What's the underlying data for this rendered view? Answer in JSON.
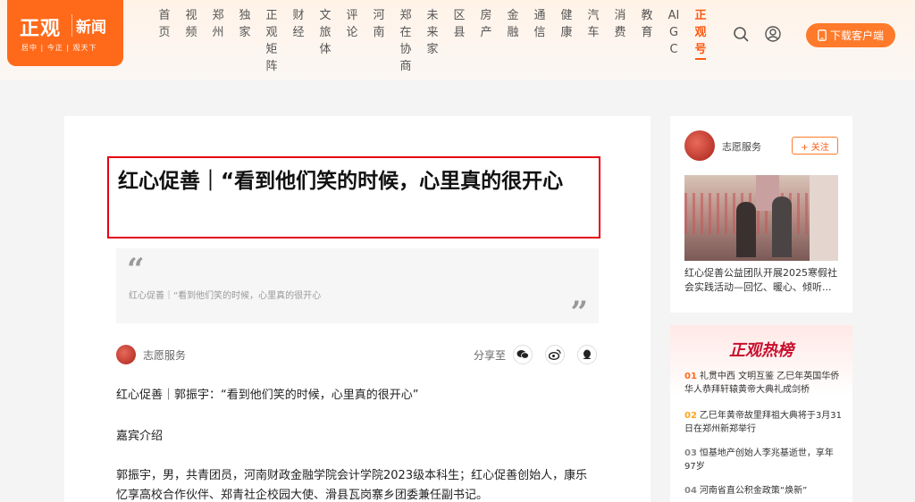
{
  "logo": {
    "brand_main": "正观",
    "brand_sub": "新闻",
    "tagline": "居中 | 今正 | 观天下"
  },
  "nav": [
    {
      "label": "首页",
      "active": false
    },
    {
      "label": "视频",
      "active": false
    },
    {
      "label": "郑州",
      "active": false
    },
    {
      "label": "独家",
      "active": false
    },
    {
      "label": "正观矩阵",
      "active": false
    },
    {
      "label": "财经",
      "active": false
    },
    {
      "label": "文旅体",
      "active": false
    },
    {
      "label": "评论",
      "active": false
    },
    {
      "label": "河南",
      "active": false
    },
    {
      "label": "郑在协商",
      "active": false
    },
    {
      "label": "未来家",
      "active": false
    },
    {
      "label": "区县",
      "active": false
    },
    {
      "label": "房产",
      "active": false
    },
    {
      "label": "金融",
      "active": false
    },
    {
      "label": "通信",
      "active": false
    },
    {
      "label": "健康",
      "active": false
    },
    {
      "label": "汽车",
      "active": false
    },
    {
      "label": "消费",
      "active": false
    },
    {
      "label": "教育",
      "active": false
    },
    {
      "label": "AIGC",
      "active": false
    },
    {
      "label": "正观号",
      "active": true
    }
  ],
  "header": {
    "download_label": "下载客户端",
    "search_icon": "search-icon",
    "user_icon": "user-icon",
    "phone_icon": "phone-icon"
  },
  "article": {
    "title": "红心促善｜“看到他们笑的时候，心里真的很开心",
    "quote_text": "红心促善｜“看到他们笑的时候，心里真的很开心",
    "author": "志愿服务",
    "share_label": "分享至",
    "share_icons": [
      "wechat-icon",
      "weibo-icon",
      "qq-icon"
    ],
    "paragraphs": [
      "红心促善｜郭振宇：“看到他们笑的时候，心里真的很开心”",
      "嘉宾介绍",
      "郭振宇，男，共青团员，河南财政金融学院会计学院2023级本科生；红心促善创始人，康乐忆享高校合作伙伴、郑青社企校园大使、滑县瓦岗寨乡团委兼任副书记。"
    ]
  },
  "sidebar": {
    "author": "志愿服务",
    "follow_label": "+ 关注",
    "caption": "红心促善公益团队开展2025寒假社会实践活动—回忆、暖心、倾听...",
    "hot_title": "正观热榜",
    "hot_list": [
      {
        "rank": "01",
        "text": "礼贯中西 文明互鉴 乙巳年英国华侨华人恭拜轩辕黄帝大典礼成剑桥"
      },
      {
        "rank": "02",
        "text": "乙巳年黄帝故里拜祖大典将于3月31日在郑州新郑举行"
      },
      {
        "rank": "03",
        "text": "恒基地产创始人李兆基逝世，享年97岁"
      },
      {
        "rank": "04",
        "text": "河南省直公积金政策“焕新”"
      }
    ]
  }
}
